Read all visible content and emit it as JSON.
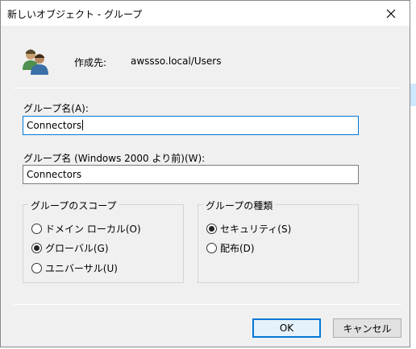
{
  "window": {
    "title": "新しいオブジェクト - グループ"
  },
  "header": {
    "create_in_label": "作成先:",
    "create_in_value": "awssso.local/Users"
  },
  "group_name": {
    "label": "グループ名(A):",
    "value": "Connectors"
  },
  "group_name_pre2000": {
    "label": "グループ名 (Windows 2000 より前)(W):",
    "value": "Connectors"
  },
  "scope": {
    "title": "グループのスコープ",
    "options": [
      {
        "label": "ドメイン ローカル(O)",
        "checked": false
      },
      {
        "label": "グローバル(G)",
        "checked": true
      },
      {
        "label": "ユニバーサル(U)",
        "checked": false
      }
    ]
  },
  "type": {
    "title": "グループの種類",
    "options": [
      {
        "label": "セキュリティ(S)",
        "checked": true
      },
      {
        "label": "配布(D)",
        "checked": false
      }
    ]
  },
  "buttons": {
    "ok": "OK",
    "cancel": "キャンセル"
  },
  "icons": {
    "close": "close-icon",
    "group": "users-group-icon"
  }
}
